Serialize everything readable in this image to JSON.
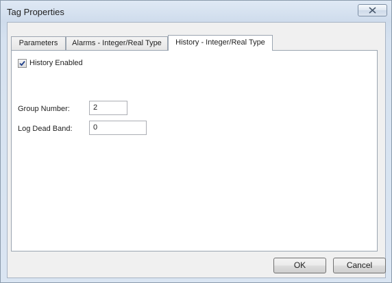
{
  "window": {
    "title": "Tag Properties"
  },
  "tabs": [
    {
      "label": "Parameters",
      "active": false
    },
    {
      "label": "Alarms - Integer/Real Type",
      "active": false
    },
    {
      "label": "History - Integer/Real Type",
      "active": true
    }
  ],
  "history": {
    "enabled_label": "History Enabled",
    "enabled": true,
    "group_number_label": "Group Number:",
    "group_number_value": "2",
    "log_dead_band_label": "Log Dead Band:",
    "log_dead_band_value": "0"
  },
  "buttons": {
    "ok_label": "OK",
    "cancel_label": "Cancel"
  },
  "icons": {
    "close": "close-icon",
    "check": "checkmark-icon"
  }
}
